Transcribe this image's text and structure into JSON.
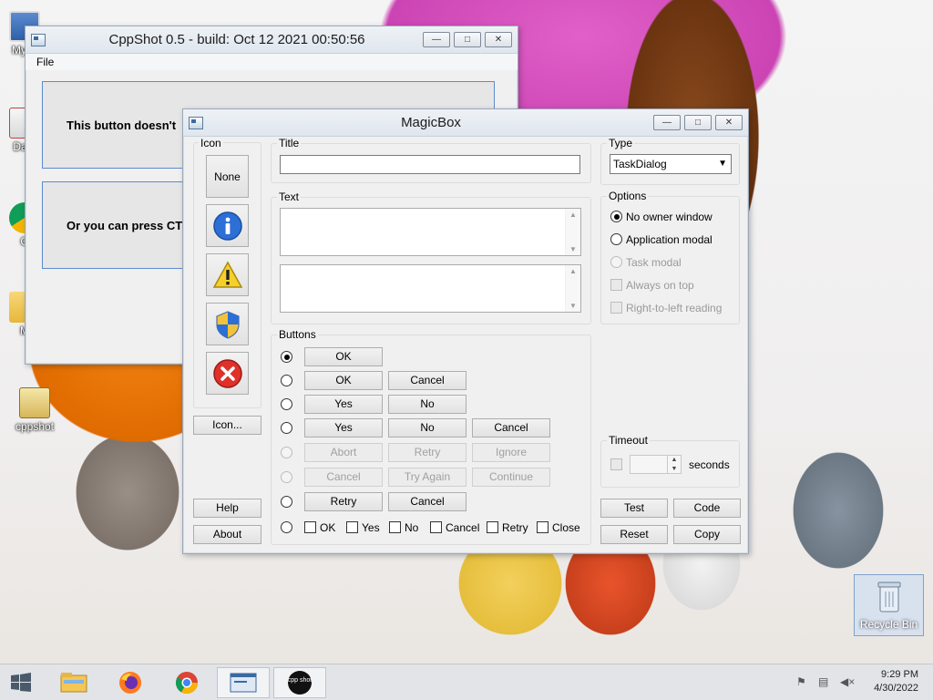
{
  "desktop": {
    "icons": [
      {
        "label": "My C"
      },
      {
        "label": "Data"
      },
      {
        "label": "G"
      },
      {
        "label": "M"
      },
      {
        "label": "cppshot"
      }
    ],
    "recycle_bin": "Recycle Bin"
  },
  "cppshot": {
    "title": "CppShot 0.5 - build: Oct 12 2021 00:50:56",
    "menu_file": "File",
    "button1": "This button doesn't",
    "button2": "Or you can press CTR"
  },
  "magicbox": {
    "title": "MagicBox",
    "icon_group": "Icon",
    "icon_none": "None",
    "icon_button": "Icon...",
    "help": "Help",
    "about": "About",
    "title_label": "Title",
    "title_value": "",
    "text_label": "Text",
    "type_label": "Type",
    "type_value": "TaskDialog",
    "options_label": "Options",
    "options": [
      {
        "label": "No owner window",
        "state": "on"
      },
      {
        "label": "Application modal",
        "state": "off"
      },
      {
        "label": "Task modal",
        "state": "disabled"
      },
      {
        "label": "Always on top",
        "state": "disabled"
      },
      {
        "label": "Right-to-left reading",
        "state": "disabled"
      }
    ],
    "buttons_label": "Buttons",
    "button_rows": [
      [
        "OK"
      ],
      [
        "OK",
        "Cancel"
      ],
      [
        "Yes",
        "No"
      ],
      [
        "Yes",
        "No",
        "Cancel"
      ],
      [
        "Abort",
        "Retry",
        "Ignore"
      ],
      [
        "Cancel",
        "Try Again",
        "Continue"
      ],
      [
        "Retry",
        "Cancel"
      ]
    ],
    "checks": [
      "OK",
      "Yes",
      "No",
      "Cancel",
      "Retry",
      "Close"
    ],
    "timeout_label": "Timeout",
    "seconds": "seconds",
    "timeout_value": "",
    "test": "Test",
    "code": "Code",
    "reset": "Reset",
    "copy": "Copy"
  },
  "taskbar": {
    "time": "9:29 PM",
    "date": "4/30/2022",
    "cpp_label": "cpp shot"
  }
}
